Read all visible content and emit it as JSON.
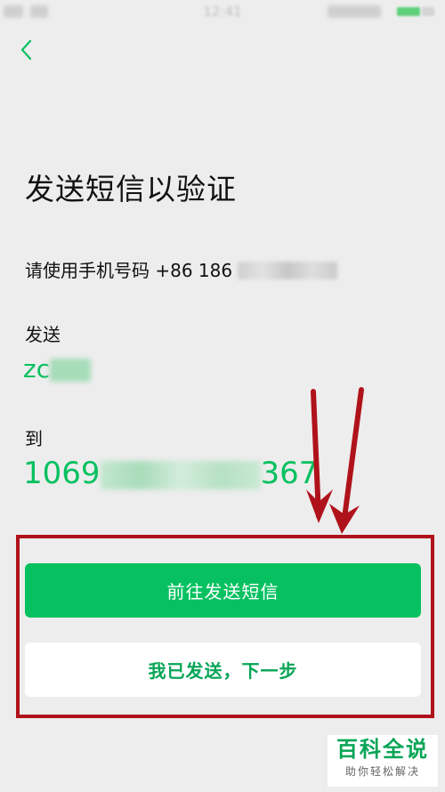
{
  "status_bar": {
    "time": "12:41"
  },
  "header": {
    "back_icon": "chevron-left-icon"
  },
  "title": "发送短信以验证",
  "instruction": {
    "prefix": "请使用手机号码 +86 186"
  },
  "send_label": "发送",
  "send_content_visible": "zc",
  "to_label": "到",
  "to_number": {
    "start": "1069",
    "end": "367"
  },
  "buttons": {
    "go_send": "前往发送短信",
    "already_sent": "我已发送，下一步"
  },
  "annotation": {
    "box_color": "#b0121b",
    "arrow_color": "#b0121b"
  },
  "watermark": {
    "title": "百科全说",
    "subtitle": "助你轻松解决"
  },
  "colors": {
    "accent": "#07c160",
    "background": "#ededed"
  }
}
